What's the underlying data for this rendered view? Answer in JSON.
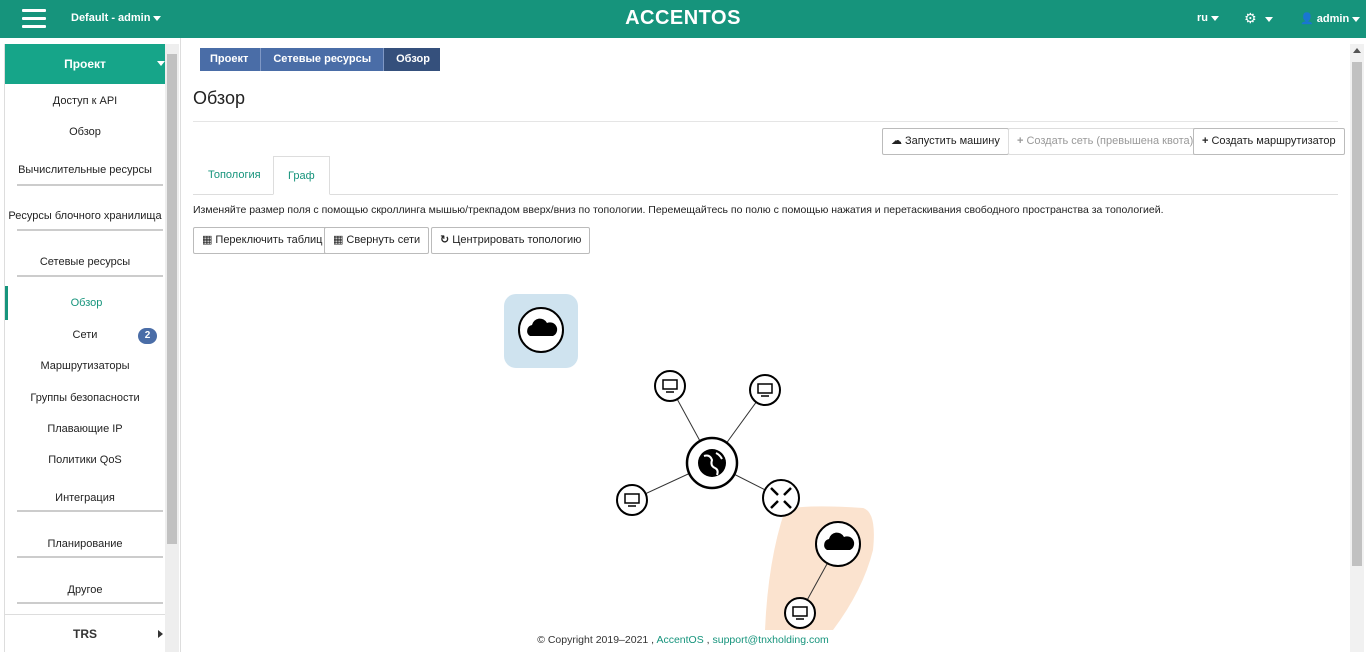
{
  "topbar": {
    "project": "Default - admin",
    "brand": "ACCENTOS",
    "lang": "ru",
    "user": "admin"
  },
  "sidebar": {
    "header": "Проект",
    "items": [
      {
        "label": "Доступ к API"
      },
      {
        "label": "Обзор"
      },
      {
        "label": "Вычислительные ресурсы"
      },
      {
        "label": "Ресурсы блочного хранилища"
      },
      {
        "label": "Сетевые ресурсы"
      },
      {
        "label": "Обзор"
      },
      {
        "label": "Сети",
        "badge": "2"
      },
      {
        "label": "Маршрутизаторы"
      },
      {
        "label": "Группы безопасности"
      },
      {
        "label": "Плавающие IP"
      },
      {
        "label": "Политики QoS"
      },
      {
        "label": "Интеграция"
      },
      {
        "label": "Планирование"
      },
      {
        "label": "Другое"
      }
    ],
    "trs": "TRS"
  },
  "breadcrumb": [
    "Проект",
    "Сетевые ресурсы",
    "Обзор"
  ],
  "page_title": "Обзор",
  "actions": {
    "launch": "Запустить машину",
    "create_net": "Создать сеть (превышена квота)",
    "create_router": "Создать маршрутизатор"
  },
  "tabs": {
    "topology": "Топология",
    "graph": "Граф"
  },
  "help_text": "Изменяйте размер поля с помощью скроллинга мышью/трекпадом вверх/вниз по топологии. Перемещайтесь по полю с помощью нажатия и перетаскивания свободного пространства за топологией.",
  "graph_controls": {
    "toggle_tables": "Переключить таблиц",
    "collapse_nets": "Свернуть сети",
    "center": "Центрировать топологию"
  },
  "footer": {
    "copyright": "© Copyright 2019–2021 ,",
    "link1": "AccentOS",
    "sep": ",",
    "link2": "support@tnxholding.com"
  },
  "colors": {
    "topbar": "#16947c",
    "accent": "#16a589",
    "breadcrumb": "#4a6da7",
    "network_highlight_blue": "#cfe3ef",
    "network_highlight_orange": "#fbe3cf"
  }
}
